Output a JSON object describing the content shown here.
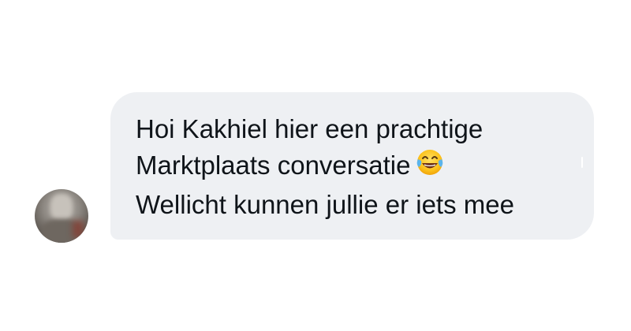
{
  "message": {
    "lines": [
      "Hoi Kakhiel hier een prachtige",
      "Marktplaats conversatie",
      "Wellicht kunnen jullie er iets mee"
    ],
    "emoji": "face-with-tears-of-joy-icon"
  },
  "avatar": {
    "icon": "avatar-icon"
  },
  "colors": {
    "bubble_background": "#eef0f3",
    "text": "#0f1419",
    "page_background": "#ffffff"
  }
}
